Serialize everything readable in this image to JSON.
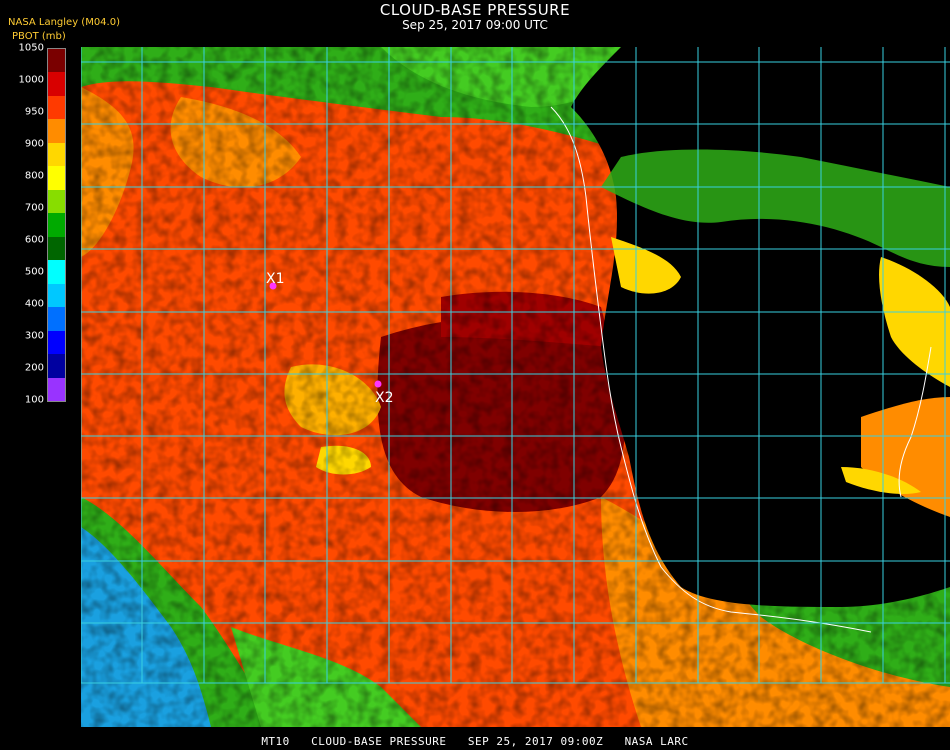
{
  "header": {
    "title": "CLOUD-BASE PRESSURE",
    "subtitle": "Sep 25, 2017 09:00 UTC",
    "source": "NASA Langley (M04.0)",
    "units": "PBOT (mb)"
  },
  "colorbar": {
    "labels": [
      "1050",
      "1000",
      "950",
      "900",
      "800",
      "700",
      "600",
      "500",
      "400",
      "300",
      "200",
      "100"
    ],
    "colors": [
      "#7a0000",
      "#d80000",
      "#ff3a00",
      "#ff8c00",
      "#ffd700",
      "#ffff00",
      "#88dd00",
      "#00aa00",
      "#006600",
      "#00ffff",
      "#00c8ff",
      "#0070ff",
      "#0000ff",
      "#0000a0",
      "#9933ff"
    ]
  },
  "markers": [
    {
      "label": "X1",
      "color": "#ff33ff"
    },
    {
      "label": "X2",
      "color": "#ff33ff"
    }
  ],
  "footer": {
    "text": "MT10   CLOUD-BASE PRESSURE   SEP 25, 2017 09:00Z   NASA LARC"
  },
  "colors": {
    "grid": "#39d0e0",
    "coast": "#ffffff",
    "land": "#000000"
  }
}
